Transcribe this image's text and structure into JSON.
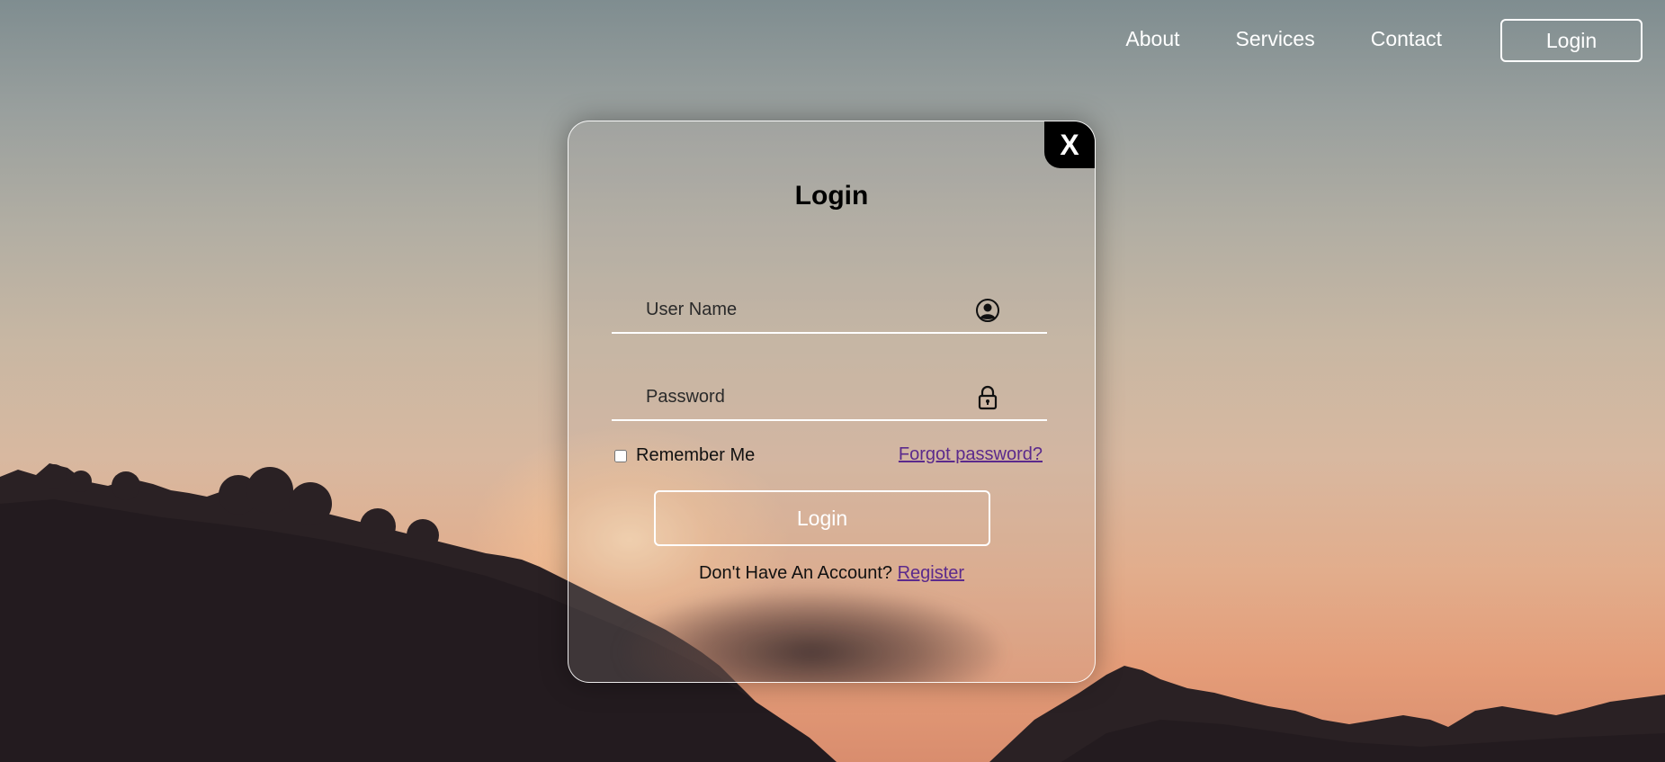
{
  "nav": {
    "links": [
      "About",
      "Services",
      "Contact"
    ],
    "login_button": "Login"
  },
  "modal": {
    "close_label": "X",
    "title": "Login",
    "username_placeholder": "User Name",
    "password_placeholder": "Password",
    "remember_label": "Remember Me",
    "forgot_label": "Forgot password?",
    "submit_label": "Login",
    "no_account_text": "Don't Have An Account?",
    "register_label": "Register"
  },
  "colors": {
    "link_purple": "#5b2a8c",
    "border_white": "#ffffff",
    "close_bg": "#000000"
  },
  "icons": {
    "username": "user-circle-icon",
    "password": "lock-icon",
    "close": "close-icon"
  }
}
